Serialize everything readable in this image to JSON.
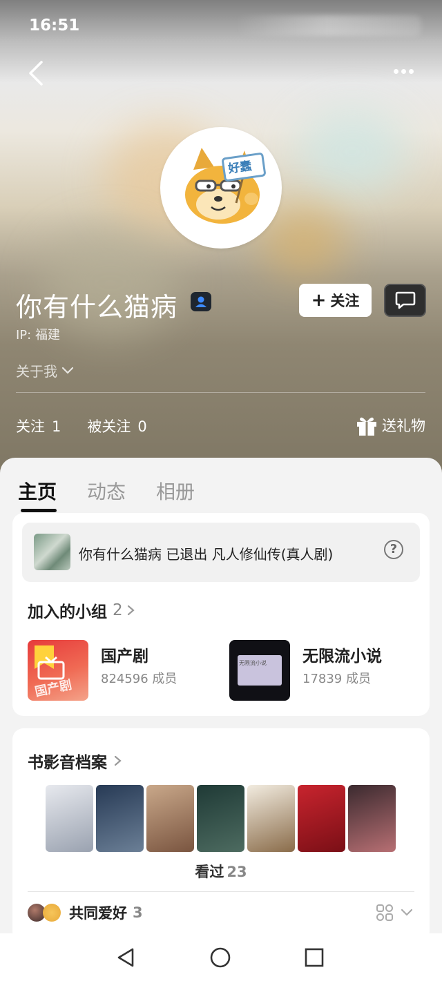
{
  "status_bar": {
    "time": "16:51"
  },
  "profile": {
    "name": "你有什么猫病",
    "ip": "IP: 福建",
    "about_label": "关于我",
    "follow_label": "关注",
    "stats": {
      "following_label": "关注",
      "following_count": "1",
      "followers_label": "被关注",
      "followers_count": "0"
    },
    "gift_label": "送礼物"
  },
  "avatar": {
    "sign_text": "好蠢"
  },
  "tabs": [
    "主页",
    "动态",
    "相册"
  ],
  "notice": {
    "text": "你有什么猫病 已退出 凡人修仙传(真人剧)",
    "help_glyph": "?"
  },
  "groups": {
    "title": "加入的小组",
    "count": "2",
    "items": [
      {
        "name": "国产剧",
        "members": "824596 成员",
        "cover_text": "国产剧"
      },
      {
        "name": "无限流小说",
        "members": "17839 成员",
        "cover_text": "无限流小说"
      }
    ]
  },
  "archive": {
    "title": "书影音档案",
    "watched_label": "看过",
    "watched_count": "23",
    "posters": [
      {
        "name": "poster-1",
        "colors": [
          "#e7e9ee",
          "#9aa2b0"
        ]
      },
      {
        "name": "poster-2",
        "colors": [
          "#273a55",
          "#6b7f96"
        ]
      },
      {
        "name": "poster-3",
        "colors": [
          "#c9a88a",
          "#7a5540"
        ]
      },
      {
        "name": "poster-4",
        "colors": [
          "#1f3a36",
          "#4d6b60"
        ]
      },
      {
        "name": "poster-5",
        "colors": [
          "#f2ece0",
          "#8a6c4a"
        ]
      },
      {
        "name": "poster-6",
        "colors": [
          "#c8242e",
          "#7a0f16"
        ]
      },
      {
        "name": "poster-7",
        "colors": [
          "#3b2a2f",
          "#b76f73"
        ]
      }
    ]
  },
  "hobbies": {
    "label": "共同爱好",
    "count": "3"
  }
}
